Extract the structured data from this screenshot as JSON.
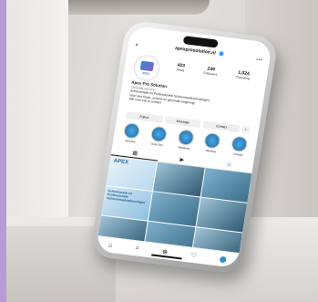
{
  "profile": {
    "handle": "apexprosolution.nl",
    "brand_short": "APEX",
    "brand_sub": "PRO",
    "name": "Apex Pro Solution",
    "category": "Cleaning Service",
    "bio_lines": [
      "Schoonmaak en Professionele Schoonmaakoplossingen",
      "Voor een frisse, schone en gezonde omgeving",
      "Klik voor info & contact"
    ]
  },
  "stats": [
    {
      "num": "423",
      "label": "Posts"
    },
    {
      "num": "249",
      "label": "Followers"
    },
    {
      "num": "1,024",
      "label": "Following"
    }
  ],
  "actions": {
    "follow": "Follow",
    "message": "Message",
    "contact": "Contact",
    "more": "+"
  },
  "highlights": [
    "Services",
    "Over Ons",
    "Vacatures",
    "Reviews",
    "Contact"
  ],
  "tabs": [
    "grid-icon",
    "reels-icon",
    "tagged-icon"
  ],
  "promo": {
    "brand": "APEX",
    "text": "Schoonmaak en Professionele Schoonmaakoplossingen"
  },
  "colors": {
    "accent": "#b79ad6",
    "brand_blue": "#2f6db0",
    "verified": "#3897f0"
  }
}
